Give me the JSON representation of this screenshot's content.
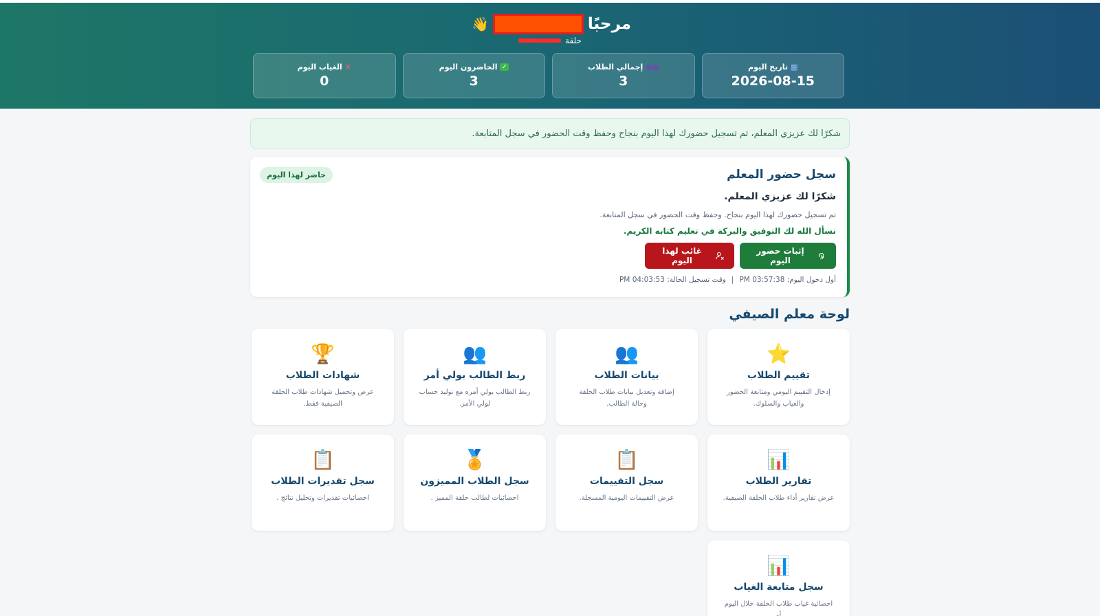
{
  "header": {
    "greeting": "مرحبًا",
    "halqa_label": "حلقة",
    "stats": [
      {
        "label": "تاريخ اليوم",
        "value": "2026-08-15",
        "icon": "calendar-icon"
      },
      {
        "label": "إجمالي الطلاب",
        "value": "3",
        "icon": "people-icon"
      },
      {
        "label": "الحاضرون اليوم",
        "value": "3",
        "icon": "check-icon"
      },
      {
        "label": "الغياب اليوم",
        "value": "0",
        "icon": "cross-icon"
      }
    ]
  },
  "alert": {
    "text": "شكرًا لك عزيزي المعلم، تم تسجيل حضورك لهذا اليوم بنجاح وحفظ وقت الحضور في سجل المتابعة."
  },
  "attendance": {
    "title": "سجل حضور المعلم",
    "badge": "حاضر لهذا اليوم",
    "thanks": "شكرًا لك عزيزي المعلم.",
    "message": "تم تسجيل حضورك لهذا اليوم بنجاح. وحفظ وقت الحضور في سجل المتابعة.",
    "dua": "نسأل الله لك التوفيق والبركة في تعليم كتابه الكريم.",
    "present_button": "إثبات حضور اليوم",
    "absent_button": "غائب لهذا اليوم",
    "first_entry": "أول دخول اليوم: 03:57:38 PM",
    "separator": "|",
    "status_time": "وقت تسجيل الحالة: 04:03:53 PM"
  },
  "dashboard": {
    "title": "لوحة معلم الصيفي",
    "tiles": [
      {
        "title": "تقييم الطلاب",
        "desc": "إدخال التقييم اليومي ومتابعة الحضور والغياب والسلوك.",
        "icon": "star-icon",
        "glyph": "⭐"
      },
      {
        "title": "بيانات الطلاب",
        "desc": "إضافة وتعديل بيانات طلاب الحلقة وحالة الطالب.",
        "icon": "people-icon",
        "glyph": "👥"
      },
      {
        "title": "ربط الطالب بولي أمر",
        "desc": "ربط الطالب بولي أمره مع توليد حساب لولي الأمر.",
        "icon": "people-icon",
        "glyph": "👥"
      },
      {
        "title": "شهادات الطلاب",
        "desc": "عرض وتحميل شهادات طلاب الحلقة الصيفية فقط.",
        "icon": "trophy-icon",
        "glyph": "🏆"
      },
      {
        "title": "تقارير الطلاب",
        "desc": "عرض تقارير أداء طلاب الحلقة الصيفية.",
        "icon": "bar-chart-icon",
        "glyph": "📊"
      },
      {
        "title": "سجل التقييمات",
        "desc": "عرض التقييمات اليومية المسجلة.",
        "icon": "clipboard-icon",
        "glyph": "📋"
      },
      {
        "title": "سجل الطلاب المميزون",
        "desc": "احصائيات لطالب حلقة المميز .",
        "icon": "medal-icon",
        "glyph": "🏅"
      },
      {
        "title": "سجل تقديرات الطلاب",
        "desc": "احصائيات تقديرات وتحليل نتائج .",
        "icon": "clipboard-icon",
        "glyph": "📋"
      },
      {
        "title": "سجل متابعة الغياب",
        "desc": "احصائية غياب طلاب الحلقة خلال اليوم أو",
        "icon": "bar-chart-icon",
        "glyph": "📊"
      }
    ]
  },
  "colors": {
    "header_start": "#1d7766",
    "header_end": "#1b4f75",
    "present_green": "#1f7d3c",
    "absent_red": "#b8161c",
    "title_blue": "#16486e"
  }
}
